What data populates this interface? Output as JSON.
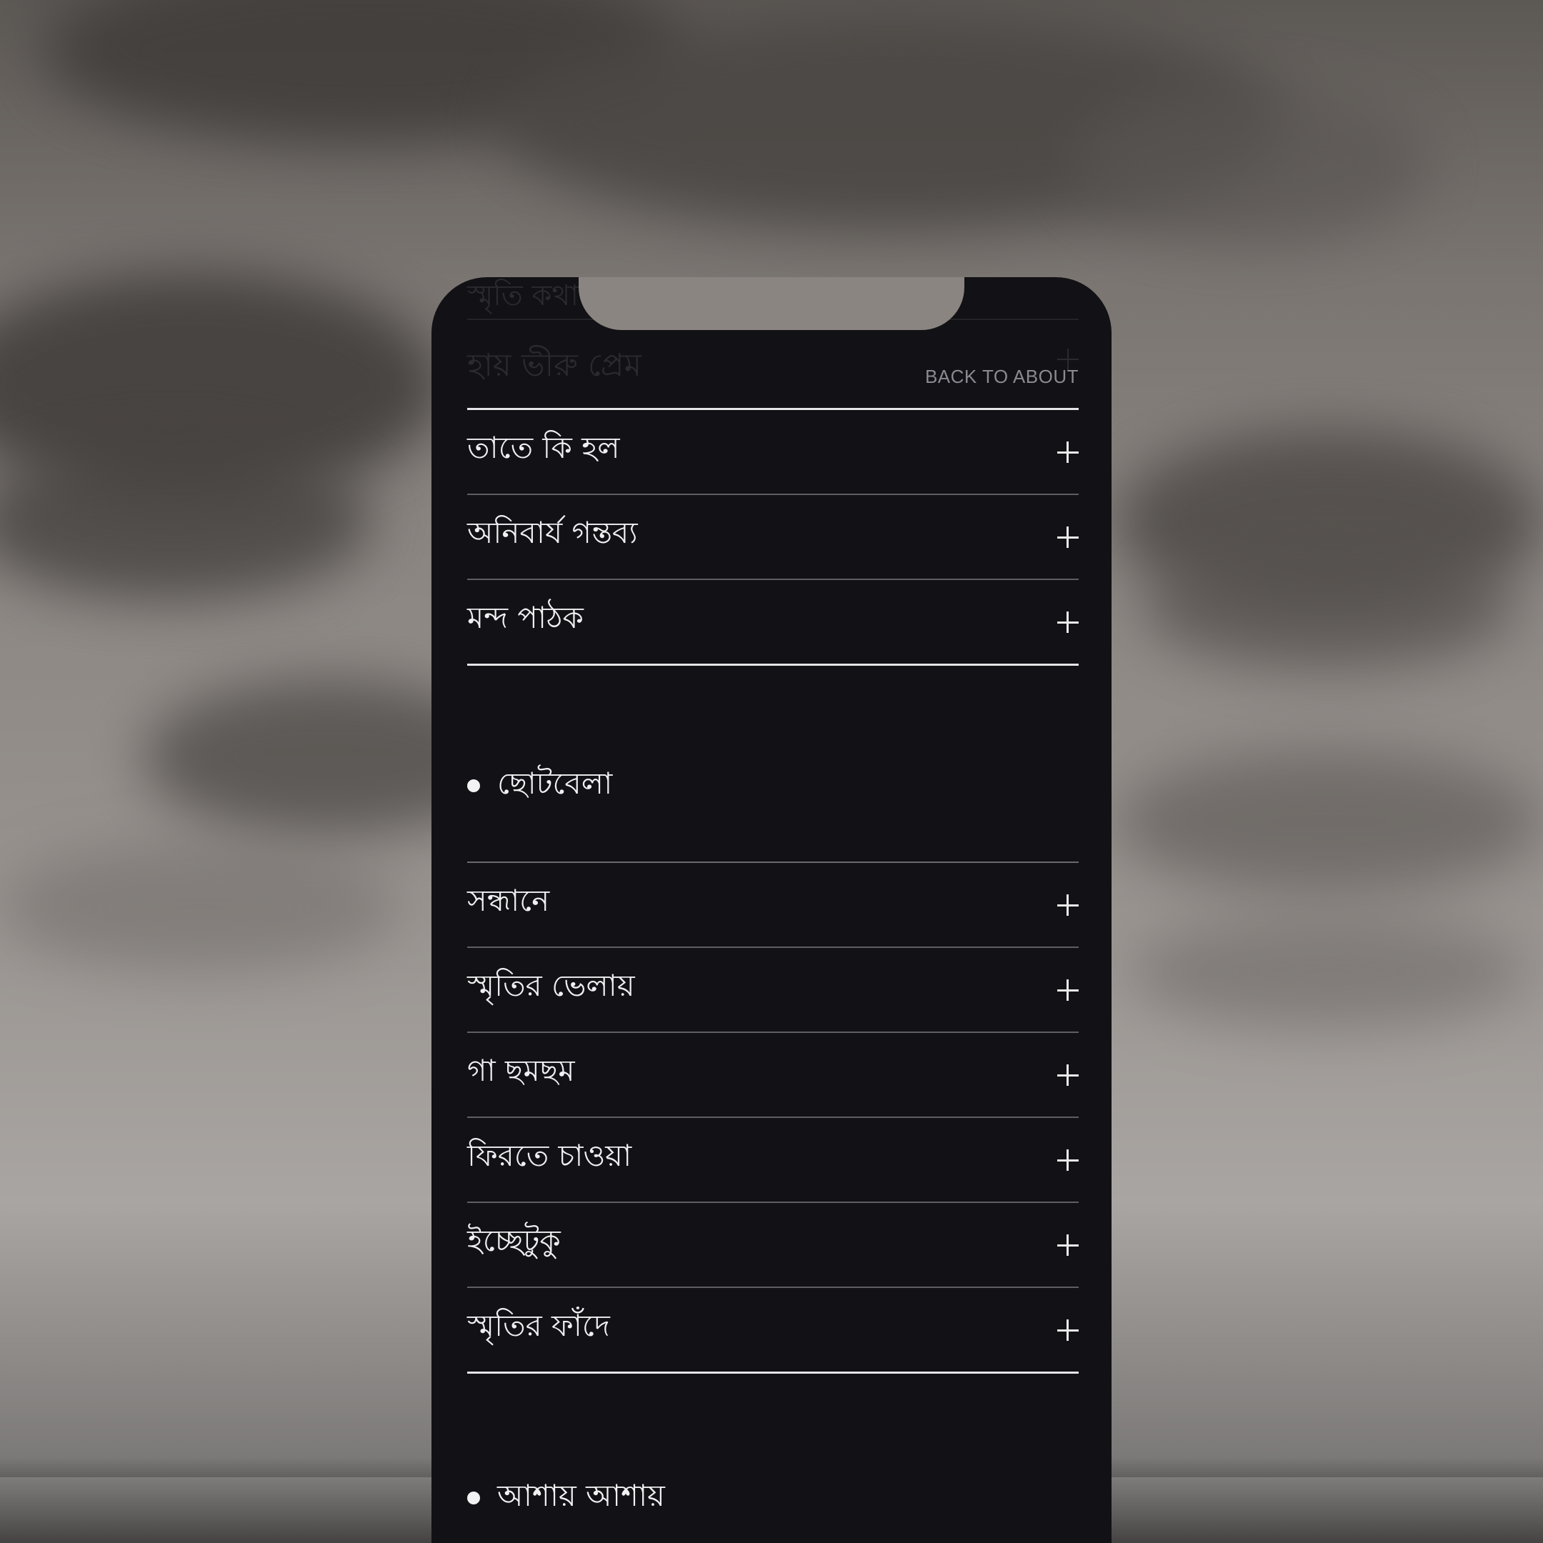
{
  "ghost": {
    "top_text": "স্মৃতি কথা",
    "row_text": "হায় ভীরু প্রেম"
  },
  "nav": {
    "back_label": "BACK TO ABOUT"
  },
  "section1": {
    "items": [
      {
        "label": "তাতে কি হল"
      },
      {
        "label": "অনিবার্য গন্তব্য"
      },
      {
        "label": "মন্দ পাঠক"
      }
    ]
  },
  "section2": {
    "title": "ছোটবেলা",
    "items": [
      {
        "label": "সন্ধানে"
      },
      {
        "label": "স্মৃতির ভেলায়"
      },
      {
        "label": "গা ছমছম"
      },
      {
        "label": "ফিরতে চাওয়া"
      },
      {
        "label": "ইচ্ছেটুকু"
      },
      {
        "label": "স্মৃতির ফাঁদে"
      }
    ]
  },
  "section3": {
    "title": "আশায় আশায়"
  },
  "icons": {
    "expand": "plus-icon",
    "bullet": "bullet-dot-icon"
  },
  "colors": {
    "panel": "#121115",
    "text": "#f0eff1",
    "divider": "#5f5e63",
    "accent_rule": "#e5e4e6",
    "muted": "#8b8a90"
  }
}
